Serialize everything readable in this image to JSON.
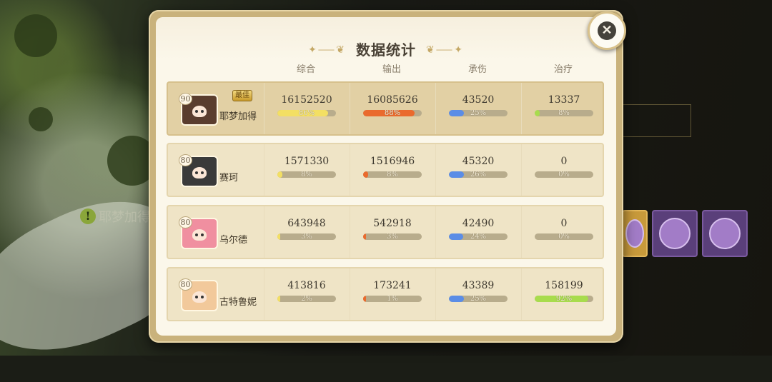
{
  "dialog": {
    "title": "数据统计",
    "title_ornament_left": "✦⸺❦",
    "title_ornament_right": "❦⸺✦",
    "close_glyph": "✕",
    "columns": [
      "综合",
      "输出",
      "承伤",
      "治疗"
    ],
    "best_label": "最佳",
    "bar_colors": {
      "overall": "#f3df63",
      "damage": "#ea6a2d",
      "tanked": "#5b8de6",
      "heal": "#a8dc4d"
    },
    "rows": [
      {
        "level": "90",
        "name": "耶梦加得",
        "is_best": true,
        "portrait_color": "#5a3d2e",
        "stats": [
          {
            "value": "16152520",
            "pct": "86%",
            "fraction": 0.86
          },
          {
            "value": "16085626",
            "pct": "88%",
            "fraction": 0.88
          },
          {
            "value": "43520",
            "pct": "25%",
            "fraction": 0.25
          },
          {
            "value": "13337",
            "pct": "8%",
            "fraction": 0.08
          }
        ]
      },
      {
        "level": "80",
        "name": "赛珂",
        "is_best": false,
        "portrait_color": "#3a3a3a",
        "stats": [
          {
            "value": "1571330",
            "pct": "8%",
            "fraction": 0.08
          },
          {
            "value": "1516946",
            "pct": "8%",
            "fraction": 0.08
          },
          {
            "value": "45320",
            "pct": "26%",
            "fraction": 0.26
          },
          {
            "value": "0",
            "pct": "0%",
            "fraction": 0
          }
        ]
      },
      {
        "level": "80",
        "name": "乌尔德",
        "is_best": false,
        "portrait_color": "#f08fa0",
        "stats": [
          {
            "value": "643948",
            "pct": "3%",
            "fraction": 0.03
          },
          {
            "value": "542918",
            "pct": "3%",
            "fraction": 0.03
          },
          {
            "value": "42490",
            "pct": "24%",
            "fraction": 0.24
          },
          {
            "value": "0",
            "pct": "0%",
            "fraction": 0
          }
        ]
      },
      {
        "level": "80",
        "name": "古特鲁妮",
        "is_best": false,
        "portrait_color": "#f2c99b",
        "stats": [
          {
            "value": "413816",
            "pct": "2%",
            "fraction": 0.02
          },
          {
            "value": "173241",
            "pct": "1%",
            "fraction": 0.01
          },
          {
            "value": "43389",
            "pct": "25%",
            "fraction": 0.25
          },
          {
            "value": "158199",
            "pct": "92%",
            "fraction": 0.92
          }
        ]
      }
    ]
  },
  "background": {
    "notice_icon": "!",
    "notice_text": "耶梦加得"
  }
}
